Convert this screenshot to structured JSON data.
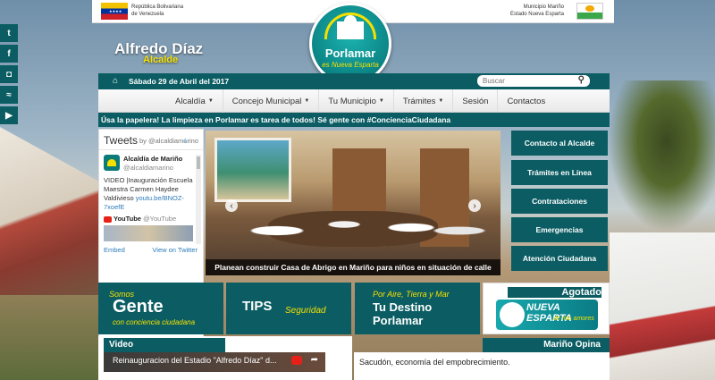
{
  "header": {
    "left_org": [
      "República Bolivariana",
      "de Venezuela"
    ],
    "right_org": [
      "Municipio Mariño",
      "Estado Nueva Esparta"
    ],
    "mayor_name": "Alfredo Díaz",
    "mayor_role": "Alcalde",
    "logo_name": "Porlamar",
    "logo_tagline": "es Nueva Esparta"
  },
  "datebar": {
    "date": "Sábado 29 de Abril del 2017",
    "search_placeholder": "Buscar"
  },
  "nav": {
    "items": [
      {
        "label": "Alcaldía",
        "dropdown": true
      },
      {
        "label": "Concejo Municipal",
        "dropdown": true
      },
      {
        "label": "Tu Municipio",
        "dropdown": true
      },
      {
        "label": "Trámites",
        "dropdown": true
      },
      {
        "label": "Sesión",
        "dropdown": false
      },
      {
        "label": "Contactos",
        "dropdown": false
      }
    ]
  },
  "ticker": "Úsa la papelera! La limpieza en Porlamar es tarea de todos! Sé gente con #ConcienciaCiudadana",
  "tweets": {
    "title": "Tweets",
    "by": "by @alcaldiamarino",
    "account": "Alcaldía de Mariño",
    "handle": "@alcaldiamarino",
    "text": "VIDEO |Inauguración Escuela Maestra Carmen Haydee Valdivieso",
    "link": "youtu.be/BNOZ-7xoefE",
    "youtube_label": "YouTube",
    "youtube_handle": "@YouTube",
    "embed": "Embed",
    "view_on": "View on Twitter"
  },
  "slider": {
    "caption": "Planean construir Casa de Abrigo en Mariño para niños en situación de calle",
    "prev": "‹",
    "next": "›"
  },
  "quick_links": [
    "Contacto al Alcalde",
    "Trámites en Línea",
    "Contrataciones",
    "Emergencias",
    "Atención Ciudadana"
  ],
  "banners": {
    "gente": {
      "top": "Somos",
      "main": "Gente",
      "bottom": "con conciencia ciudadana"
    },
    "tips": {
      "main": "TIPS",
      "sub": "Seguridad"
    },
    "destino": {
      "top": "Por Aire, Tierra y Mar",
      "line1": "Tu Destino",
      "line2": "Porlamar"
    },
    "agotado": {
      "title": "Agotado",
      "ad_main": "NUEVA ESPARTA",
      "ad_sub": "de mis amores"
    }
  },
  "video": {
    "heading": "Video",
    "title": "Reinauguracion del Estadio \"Alfredo Díaz\" d..."
  },
  "opina": {
    "heading": "Mariño Opina",
    "text": "Sacudón, economía del empobrecimiento."
  },
  "social": [
    "twitter",
    "facebook",
    "instagram",
    "rss",
    "youtube"
  ],
  "colors": {
    "primary": "#0b5d63",
    "accent": "#f5e000"
  }
}
